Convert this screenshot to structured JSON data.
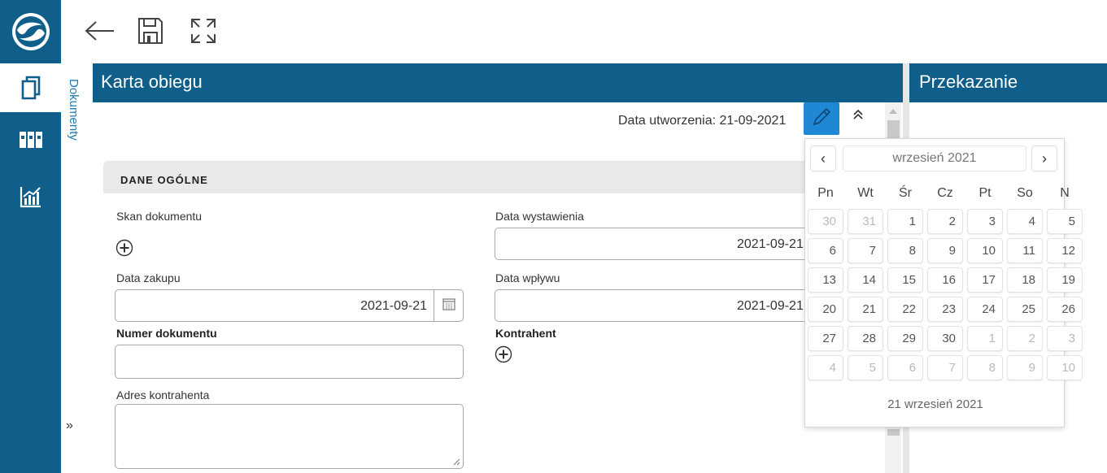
{
  "toolbar": {
    "back_icon": "arrow-left-icon",
    "save_icon": "floppy-disk-icon",
    "fullscreen_icon": "expand-icon"
  },
  "rail": {
    "logo": "app-logo",
    "items": [
      {
        "icon": "documents-icon",
        "active": true
      },
      {
        "icon": "binders-icon",
        "active": false
      },
      {
        "icon": "chart-icon",
        "active": false
      }
    ]
  },
  "sidetab": {
    "label": "Dokumenty",
    "expand": "»"
  },
  "panel": {
    "title": "Karta obiegu",
    "created_text": "Data utworzenia: 21-09-2021"
  },
  "right_panel": {
    "title": "Przekazanie"
  },
  "section": {
    "title": "DANE OGÓLNE"
  },
  "form": {
    "scan_label": "Skan dokumentu",
    "issue_date_label": "Data wystawienia",
    "issue_date_value": "2021-09-21",
    "purchase_date_label": "Data zakupu",
    "purchase_date_value": "2021-09-21",
    "receipt_date_label": "Data wpływu",
    "receipt_date_value": "2021-09-21",
    "doc_number_label": "Numer dokumentu",
    "doc_number_value": "",
    "contractor_label": "Kontrahent",
    "contractor_address_label": "Adres kontrahenta",
    "contractor_address_value": ""
  },
  "datepicker": {
    "month_label": "wrzesień 2021",
    "prev": "‹",
    "next": "›",
    "weekdays": [
      "Pn",
      "Wt",
      "Śr",
      "Cz",
      "Pt",
      "So",
      "N"
    ],
    "weeks": [
      [
        "30",
        "31",
        "1",
        "2",
        "3",
        "4",
        "5"
      ],
      [
        "6",
        "7",
        "8",
        "9",
        "10",
        "11",
        "12"
      ],
      [
        "13",
        "14",
        "15",
        "16",
        "17",
        "18",
        "19"
      ],
      [
        "20",
        "21",
        "22",
        "23",
        "24",
        "25",
        "26"
      ],
      [
        "27",
        "28",
        "29",
        "30",
        "1",
        "2",
        "3"
      ],
      [
        "4",
        "5",
        "6",
        "7",
        "8",
        "9",
        "10"
      ]
    ],
    "footer": "21 wrzesień 2021"
  },
  "colors": {
    "brand": "#0f5f8a",
    "accent": "#1e88d6"
  }
}
